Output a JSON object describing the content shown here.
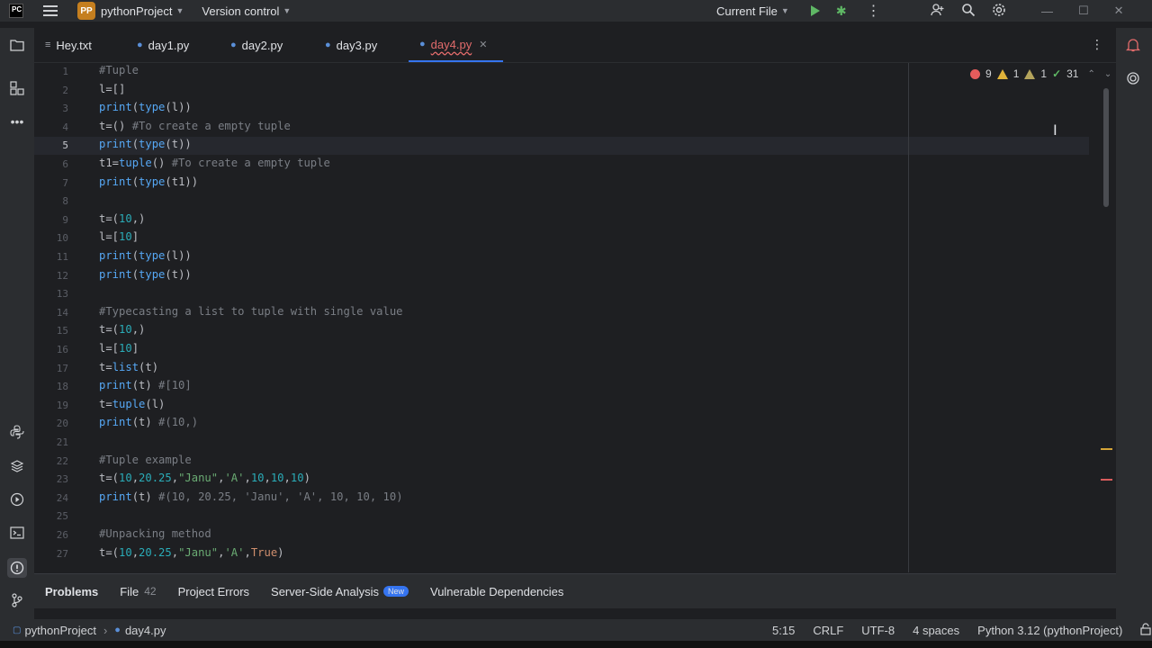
{
  "titlebar": {
    "app_logo": "PC",
    "project_badge": "PP",
    "project_name": "pythonProject",
    "version_control": "Version control",
    "run_config": "Current File",
    "icons": [
      "add-user-icon",
      "search-icon",
      "settings-icon"
    ],
    "window_controls": [
      "minimize-icon",
      "maximize-icon",
      "close-icon"
    ]
  },
  "tabs": [
    {
      "label": "Hey.txt",
      "icon": "text-file-icon"
    },
    {
      "label": "day1.py",
      "icon": "python-file-icon"
    },
    {
      "label": "day2.py",
      "icon": "python-file-icon"
    },
    {
      "label": "day3.py",
      "icon": "python-file-icon"
    },
    {
      "label": "day4.py",
      "icon": "python-file-icon",
      "active": true
    }
  ],
  "inspections": {
    "errors": "9",
    "warnings": "1",
    "weak_warnings": "1",
    "ok": "31"
  },
  "editor": {
    "current_line": 5,
    "lines": [
      {
        "n": "1",
        "text": "#Tuple"
      },
      {
        "n": "2",
        "text": "l=[]"
      },
      {
        "n": "3",
        "text": "print(type(l))"
      },
      {
        "n": "4",
        "text": "t=() #To create a empty tuple"
      },
      {
        "n": "5",
        "text": "print(type(t))"
      },
      {
        "n": "6",
        "text": "t1=tuple() #To create a empty tuple"
      },
      {
        "n": "7",
        "text": "print(type(t1))"
      },
      {
        "n": "8",
        "text": ""
      },
      {
        "n": "9",
        "text": "t=(10,)"
      },
      {
        "n": "10",
        "text": "l=[10]"
      },
      {
        "n": "11",
        "text": "print(type(l))"
      },
      {
        "n": "12",
        "text": "print(type(t))"
      },
      {
        "n": "13",
        "text": ""
      },
      {
        "n": "14",
        "text": "#Typecasting a list to tuple with single value"
      },
      {
        "n": "15",
        "text": "t=(10,)"
      },
      {
        "n": "16",
        "text": "l=[10]"
      },
      {
        "n": "17",
        "text": "t=list(t)"
      },
      {
        "n": "18",
        "text": "print(t) #[10]"
      },
      {
        "n": "19",
        "text": "t=tuple(l)"
      },
      {
        "n": "20",
        "text": "print(t) #(10,)"
      },
      {
        "n": "21",
        "text": ""
      },
      {
        "n": "22",
        "text": "#Tuple example"
      },
      {
        "n": "23",
        "text": "t=(10,20.25,\"Janu\",'A',10,10,10)"
      },
      {
        "n": "24",
        "text": "print(t) #(10, 20.25, 'Janu', 'A', 10, 10, 10)"
      },
      {
        "n": "25",
        "text": ""
      },
      {
        "n": "26",
        "text": "#Unpacking method"
      },
      {
        "n": "27",
        "text": "t=(10,20.25,\"Janu\",'A',True)"
      }
    ]
  },
  "problems": {
    "title": "Problems",
    "file_label": "File",
    "file_count": "42",
    "project_errors": "Project Errors",
    "server_side": "Server-Side Analysis",
    "new_badge": "New",
    "vulnerable": "Vulnerable Dependencies"
  },
  "statusbar": {
    "project": "pythonProject",
    "file": "day4.py",
    "position": "5:15",
    "line_sep": "CRLF",
    "encoding": "UTF-8",
    "indent": "4 spaces",
    "interpreter": "Python 3.12 (pythonProject)"
  },
  "colors": {
    "accent": "#3574f0",
    "error": "#e55c5c",
    "warning": "#e0b33a",
    "ok": "#5fb865",
    "badge": "#c57f1f"
  }
}
